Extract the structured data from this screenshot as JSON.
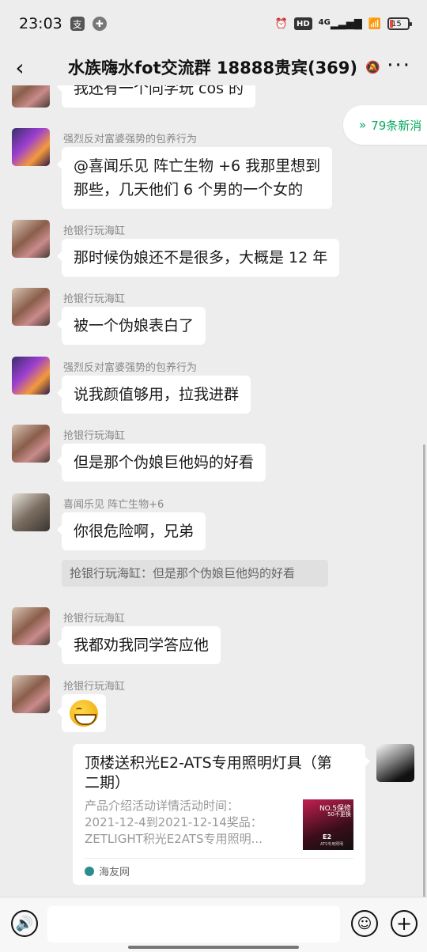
{
  "status": {
    "time": "23:03",
    "pay_icon": "支",
    "battery": "15",
    "battery_level": 0.15,
    "icons": [
      "alarm-icon",
      "hd-icon",
      "4g-signal-icon",
      "wifi-icon",
      "battery-icon"
    ],
    "hd_label": "HD",
    "network_label": "4G"
  },
  "header": {
    "title": "水族嗨水fot交流群 18888贵宾(369)",
    "back_icon": "chevron-left-icon",
    "more_icon": "more-icon"
  },
  "new_messages": {
    "label": "79条新消",
    "icon": "double-up-chevron-icon",
    "accent": "#07a860"
  },
  "messages": [
    {
      "sender": "",
      "text": "我还有一个同学玩 cos 的"
    },
    {
      "sender": "强烈反对富婆强势的包养行为",
      "line1": "@喜闻乐见  阵亡生物 +6   我那里想到",
      "line2": "那些，几天他们 6 个男的一个女的"
    },
    {
      "sender": "抢银行玩海缸",
      "text": "那时候伪娘还不是很多，大概是 12 年"
    },
    {
      "sender": "抢银行玩海缸",
      "text": "被一个伪娘表白了"
    },
    {
      "sender": "强烈反对富婆强势的包养行为",
      "text": "说我颜值够用，拉我进群"
    },
    {
      "sender": "抢银行玩海缸",
      "text": "但是那个伪娘巨他妈的好看"
    },
    {
      "sender": "喜闻乐见  阵亡生物+6",
      "text": "你很危险啊，兄弟",
      "quote": "抢银行玩海缸：但是那个伪娘巨他妈的好看"
    },
    {
      "sender": "抢银行玩海缸",
      "text": "我都劝我同学答应他"
    },
    {
      "sender": "抢银行玩海缸",
      "emoji": "laughing-emoji"
    }
  ],
  "link_card": {
    "title": "顶楼送积光E2-ATS专用照明灯具（第二期）",
    "desc_lines": [
      "产品介绍活动详情活动时间：",
      "2021-12-4到2021-12-14奖品：",
      "ZETLIGHT积光E2ATS专用照明..."
    ],
    "thumb_text_1": "NO.5保修",
    "thumb_text_2": "50不更换",
    "thumb_text_3": "E2",
    "thumb_text_4": "ATS专用照明",
    "source": "海友网"
  },
  "input_bar": {
    "voice_icon": "voice-icon",
    "emoji_icon": "emoji-icon",
    "add_icon": "plus-icon",
    "placeholder": ""
  }
}
